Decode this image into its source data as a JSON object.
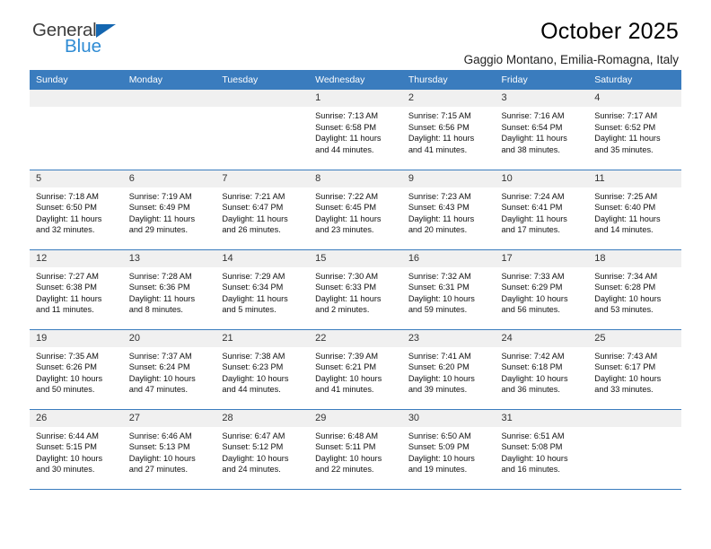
{
  "brand": {
    "name_part1": "General",
    "name_part2": "Blue",
    "accent_color": "#2e8bd4",
    "triangle_color": "#1466b0"
  },
  "header": {
    "title": "October 2025",
    "subtitle": "Gaggio Montano, Emilia-Romagna, Italy"
  },
  "theme": {
    "header_row_bg": "#3a7cbe",
    "daynum_bg": "#f0f0f0",
    "row_border": "#3a7cbe"
  },
  "weekdays": [
    "Sunday",
    "Monday",
    "Tuesday",
    "Wednesday",
    "Thursday",
    "Friday",
    "Saturday"
  ],
  "weeks": [
    [
      {
        "day": "",
        "lines": []
      },
      {
        "day": "",
        "lines": []
      },
      {
        "day": "",
        "lines": []
      },
      {
        "day": "1",
        "lines": [
          "Sunrise: 7:13 AM",
          "Sunset: 6:58 PM",
          "Daylight: 11 hours",
          "and 44 minutes."
        ]
      },
      {
        "day": "2",
        "lines": [
          "Sunrise: 7:15 AM",
          "Sunset: 6:56 PM",
          "Daylight: 11 hours",
          "and 41 minutes."
        ]
      },
      {
        "day": "3",
        "lines": [
          "Sunrise: 7:16 AM",
          "Sunset: 6:54 PM",
          "Daylight: 11 hours",
          "and 38 minutes."
        ]
      },
      {
        "day": "4",
        "lines": [
          "Sunrise: 7:17 AM",
          "Sunset: 6:52 PM",
          "Daylight: 11 hours",
          "and 35 minutes."
        ]
      }
    ],
    [
      {
        "day": "5",
        "lines": [
          "Sunrise: 7:18 AM",
          "Sunset: 6:50 PM",
          "Daylight: 11 hours",
          "and 32 minutes."
        ]
      },
      {
        "day": "6",
        "lines": [
          "Sunrise: 7:19 AM",
          "Sunset: 6:49 PM",
          "Daylight: 11 hours",
          "and 29 minutes."
        ]
      },
      {
        "day": "7",
        "lines": [
          "Sunrise: 7:21 AM",
          "Sunset: 6:47 PM",
          "Daylight: 11 hours",
          "and 26 minutes."
        ]
      },
      {
        "day": "8",
        "lines": [
          "Sunrise: 7:22 AM",
          "Sunset: 6:45 PM",
          "Daylight: 11 hours",
          "and 23 minutes."
        ]
      },
      {
        "day": "9",
        "lines": [
          "Sunrise: 7:23 AM",
          "Sunset: 6:43 PM",
          "Daylight: 11 hours",
          "and 20 minutes."
        ]
      },
      {
        "day": "10",
        "lines": [
          "Sunrise: 7:24 AM",
          "Sunset: 6:41 PM",
          "Daylight: 11 hours",
          "and 17 minutes."
        ]
      },
      {
        "day": "11",
        "lines": [
          "Sunrise: 7:25 AM",
          "Sunset: 6:40 PM",
          "Daylight: 11 hours",
          "and 14 minutes."
        ]
      }
    ],
    [
      {
        "day": "12",
        "lines": [
          "Sunrise: 7:27 AM",
          "Sunset: 6:38 PM",
          "Daylight: 11 hours",
          "and 11 minutes."
        ]
      },
      {
        "day": "13",
        "lines": [
          "Sunrise: 7:28 AM",
          "Sunset: 6:36 PM",
          "Daylight: 11 hours",
          "and 8 minutes."
        ]
      },
      {
        "day": "14",
        "lines": [
          "Sunrise: 7:29 AM",
          "Sunset: 6:34 PM",
          "Daylight: 11 hours",
          "and 5 minutes."
        ]
      },
      {
        "day": "15",
        "lines": [
          "Sunrise: 7:30 AM",
          "Sunset: 6:33 PM",
          "Daylight: 11 hours",
          "and 2 minutes."
        ]
      },
      {
        "day": "16",
        "lines": [
          "Sunrise: 7:32 AM",
          "Sunset: 6:31 PM",
          "Daylight: 10 hours",
          "and 59 minutes."
        ]
      },
      {
        "day": "17",
        "lines": [
          "Sunrise: 7:33 AM",
          "Sunset: 6:29 PM",
          "Daylight: 10 hours",
          "and 56 minutes."
        ]
      },
      {
        "day": "18",
        "lines": [
          "Sunrise: 7:34 AM",
          "Sunset: 6:28 PM",
          "Daylight: 10 hours",
          "and 53 minutes."
        ]
      }
    ],
    [
      {
        "day": "19",
        "lines": [
          "Sunrise: 7:35 AM",
          "Sunset: 6:26 PM",
          "Daylight: 10 hours",
          "and 50 minutes."
        ]
      },
      {
        "day": "20",
        "lines": [
          "Sunrise: 7:37 AM",
          "Sunset: 6:24 PM",
          "Daylight: 10 hours",
          "and 47 minutes."
        ]
      },
      {
        "day": "21",
        "lines": [
          "Sunrise: 7:38 AM",
          "Sunset: 6:23 PM",
          "Daylight: 10 hours",
          "and 44 minutes."
        ]
      },
      {
        "day": "22",
        "lines": [
          "Sunrise: 7:39 AM",
          "Sunset: 6:21 PM",
          "Daylight: 10 hours",
          "and 41 minutes."
        ]
      },
      {
        "day": "23",
        "lines": [
          "Sunrise: 7:41 AM",
          "Sunset: 6:20 PM",
          "Daylight: 10 hours",
          "and 39 minutes."
        ]
      },
      {
        "day": "24",
        "lines": [
          "Sunrise: 7:42 AM",
          "Sunset: 6:18 PM",
          "Daylight: 10 hours",
          "and 36 minutes."
        ]
      },
      {
        "day": "25",
        "lines": [
          "Sunrise: 7:43 AM",
          "Sunset: 6:17 PM",
          "Daylight: 10 hours",
          "and 33 minutes."
        ]
      }
    ],
    [
      {
        "day": "26",
        "lines": [
          "Sunrise: 6:44 AM",
          "Sunset: 5:15 PM",
          "Daylight: 10 hours",
          "and 30 minutes."
        ]
      },
      {
        "day": "27",
        "lines": [
          "Sunrise: 6:46 AM",
          "Sunset: 5:13 PM",
          "Daylight: 10 hours",
          "and 27 minutes."
        ]
      },
      {
        "day": "28",
        "lines": [
          "Sunrise: 6:47 AM",
          "Sunset: 5:12 PM",
          "Daylight: 10 hours",
          "and 24 minutes."
        ]
      },
      {
        "day": "29",
        "lines": [
          "Sunrise: 6:48 AM",
          "Sunset: 5:11 PM",
          "Daylight: 10 hours",
          "and 22 minutes."
        ]
      },
      {
        "day": "30",
        "lines": [
          "Sunrise: 6:50 AM",
          "Sunset: 5:09 PM",
          "Daylight: 10 hours",
          "and 19 minutes."
        ]
      },
      {
        "day": "31",
        "lines": [
          "Sunrise: 6:51 AM",
          "Sunset: 5:08 PM",
          "Daylight: 10 hours",
          "and 16 minutes."
        ]
      },
      {
        "day": "",
        "lines": []
      }
    ]
  ]
}
